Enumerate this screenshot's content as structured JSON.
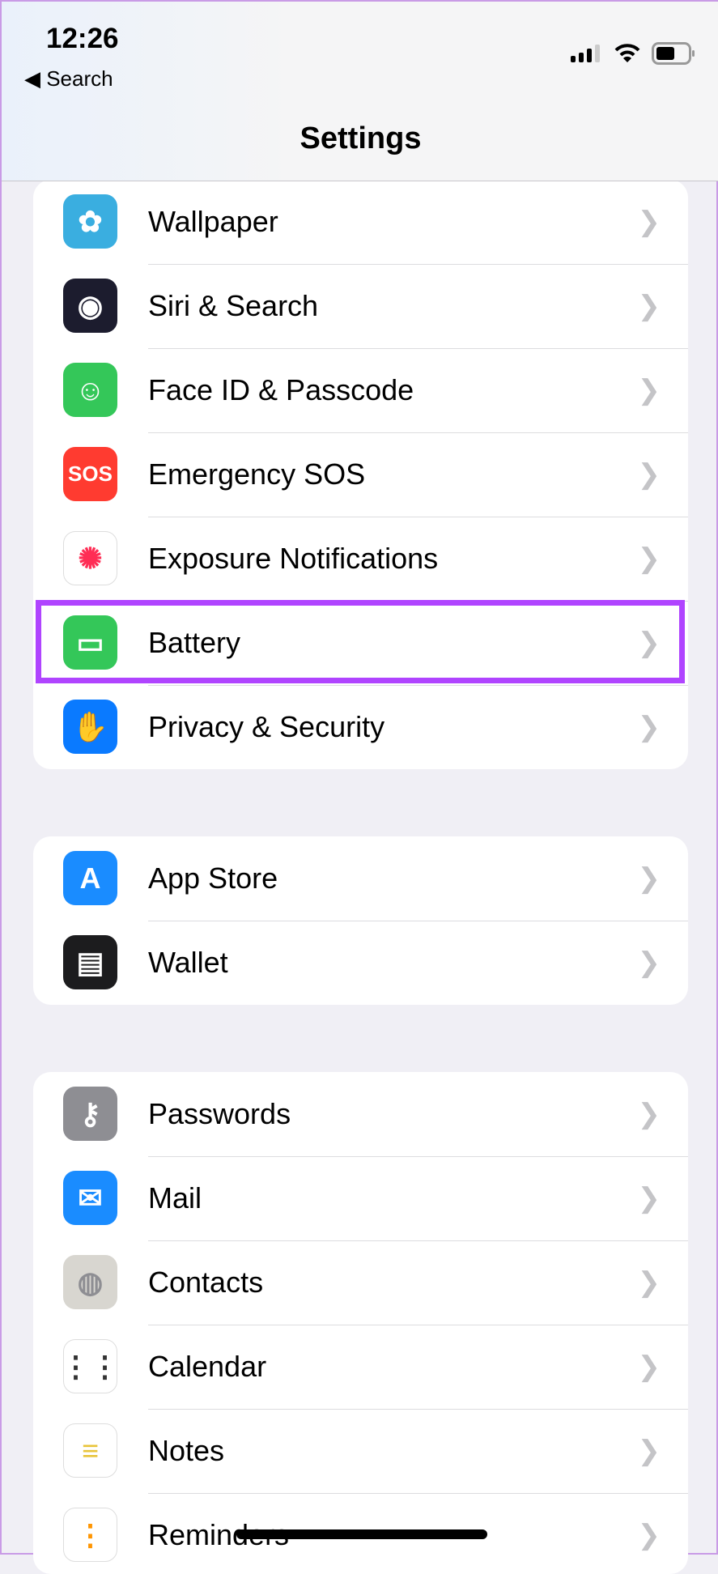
{
  "status_bar": {
    "time": "12:26",
    "back_label": "Search",
    "icons": [
      "cellular-signal-icon",
      "wifi-icon",
      "battery-icon"
    ]
  },
  "header": {
    "title": "Settings"
  },
  "highlight_color": "#b044ff",
  "groups": [
    {
      "items": [
        {
          "label": "Wallpaper",
          "icon": "wallpaper-icon",
          "color": "#3aaee0"
        },
        {
          "label": "Siri & Search",
          "icon": "siri-icon",
          "color": "#1c1c2e"
        },
        {
          "label": "Face ID & Passcode",
          "icon": "face-id-icon",
          "color": "#34c759"
        },
        {
          "label": "Emergency SOS",
          "icon": "sos-icon",
          "color": "#ff3b30",
          "glyph": "SOS"
        },
        {
          "label": "Exposure Notifications",
          "icon": "exposure-icon",
          "color": "#ffffff"
        },
        {
          "label": "Battery",
          "icon": "battery-icon",
          "color": "#34c759"
        },
        {
          "label": "Privacy & Security",
          "icon": "hand-icon",
          "color": "#0a7aff"
        }
      ]
    },
    {
      "items": [
        {
          "label": "App Store",
          "icon": "app-store-icon",
          "color": "#1a8cff"
        },
        {
          "label": "Wallet",
          "icon": "wallet-icon",
          "color": "#1c1c1e"
        }
      ]
    },
    {
      "items": [
        {
          "label": "Passwords",
          "icon": "key-icon",
          "color": "#8e8e93"
        },
        {
          "label": "Mail",
          "icon": "mail-icon",
          "color": "#1a8cff"
        },
        {
          "label": "Contacts",
          "icon": "contacts-icon",
          "color": "#d8d6d0"
        },
        {
          "label": "Calendar",
          "icon": "calendar-icon",
          "color": "#ffffff"
        },
        {
          "label": "Notes",
          "icon": "notes-icon",
          "color": "#ffffff"
        },
        {
          "label": "Reminders",
          "icon": "reminders-icon",
          "color": "#ffffff"
        }
      ]
    }
  ]
}
